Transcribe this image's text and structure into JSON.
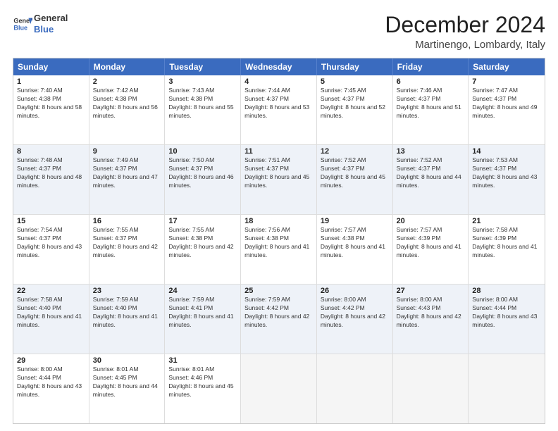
{
  "logo": {
    "line1": "General",
    "line2": "Blue"
  },
  "header": {
    "month": "December 2024",
    "location": "Martinengo, Lombardy, Italy"
  },
  "days_of_week": [
    "Sunday",
    "Monday",
    "Tuesday",
    "Wednesday",
    "Thursday",
    "Friday",
    "Saturday"
  ],
  "weeks": [
    {
      "alt": false,
      "cells": [
        {
          "day": "1",
          "sunrise": "Sunrise: 7:40 AM",
          "sunset": "Sunset: 4:38 PM",
          "daylight": "Daylight: 8 hours and 58 minutes."
        },
        {
          "day": "2",
          "sunrise": "Sunrise: 7:42 AM",
          "sunset": "Sunset: 4:38 PM",
          "daylight": "Daylight: 8 hours and 56 minutes."
        },
        {
          "day": "3",
          "sunrise": "Sunrise: 7:43 AM",
          "sunset": "Sunset: 4:38 PM",
          "daylight": "Daylight: 8 hours and 55 minutes."
        },
        {
          "day": "4",
          "sunrise": "Sunrise: 7:44 AM",
          "sunset": "Sunset: 4:37 PM",
          "daylight": "Daylight: 8 hours and 53 minutes."
        },
        {
          "day": "5",
          "sunrise": "Sunrise: 7:45 AM",
          "sunset": "Sunset: 4:37 PM",
          "daylight": "Daylight: 8 hours and 52 minutes."
        },
        {
          "day": "6",
          "sunrise": "Sunrise: 7:46 AM",
          "sunset": "Sunset: 4:37 PM",
          "daylight": "Daylight: 8 hours and 51 minutes."
        },
        {
          "day": "7",
          "sunrise": "Sunrise: 7:47 AM",
          "sunset": "Sunset: 4:37 PM",
          "daylight": "Daylight: 8 hours and 49 minutes."
        }
      ]
    },
    {
      "alt": true,
      "cells": [
        {
          "day": "8",
          "sunrise": "Sunrise: 7:48 AM",
          "sunset": "Sunset: 4:37 PM",
          "daylight": "Daylight: 8 hours and 48 minutes."
        },
        {
          "day": "9",
          "sunrise": "Sunrise: 7:49 AM",
          "sunset": "Sunset: 4:37 PM",
          "daylight": "Daylight: 8 hours and 47 minutes."
        },
        {
          "day": "10",
          "sunrise": "Sunrise: 7:50 AM",
          "sunset": "Sunset: 4:37 PM",
          "daylight": "Daylight: 8 hours and 46 minutes."
        },
        {
          "day": "11",
          "sunrise": "Sunrise: 7:51 AM",
          "sunset": "Sunset: 4:37 PM",
          "daylight": "Daylight: 8 hours and 45 minutes."
        },
        {
          "day": "12",
          "sunrise": "Sunrise: 7:52 AM",
          "sunset": "Sunset: 4:37 PM",
          "daylight": "Daylight: 8 hours and 45 minutes."
        },
        {
          "day": "13",
          "sunrise": "Sunrise: 7:52 AM",
          "sunset": "Sunset: 4:37 PM",
          "daylight": "Daylight: 8 hours and 44 minutes."
        },
        {
          "day": "14",
          "sunrise": "Sunrise: 7:53 AM",
          "sunset": "Sunset: 4:37 PM",
          "daylight": "Daylight: 8 hours and 43 minutes."
        }
      ]
    },
    {
      "alt": false,
      "cells": [
        {
          "day": "15",
          "sunrise": "Sunrise: 7:54 AM",
          "sunset": "Sunset: 4:37 PM",
          "daylight": "Daylight: 8 hours and 43 minutes."
        },
        {
          "day": "16",
          "sunrise": "Sunrise: 7:55 AM",
          "sunset": "Sunset: 4:37 PM",
          "daylight": "Daylight: 8 hours and 42 minutes."
        },
        {
          "day": "17",
          "sunrise": "Sunrise: 7:55 AM",
          "sunset": "Sunset: 4:38 PM",
          "daylight": "Daylight: 8 hours and 42 minutes."
        },
        {
          "day": "18",
          "sunrise": "Sunrise: 7:56 AM",
          "sunset": "Sunset: 4:38 PM",
          "daylight": "Daylight: 8 hours and 41 minutes."
        },
        {
          "day": "19",
          "sunrise": "Sunrise: 7:57 AM",
          "sunset": "Sunset: 4:38 PM",
          "daylight": "Daylight: 8 hours and 41 minutes."
        },
        {
          "day": "20",
          "sunrise": "Sunrise: 7:57 AM",
          "sunset": "Sunset: 4:39 PM",
          "daylight": "Daylight: 8 hours and 41 minutes."
        },
        {
          "day": "21",
          "sunrise": "Sunrise: 7:58 AM",
          "sunset": "Sunset: 4:39 PM",
          "daylight": "Daylight: 8 hours and 41 minutes."
        }
      ]
    },
    {
      "alt": true,
      "cells": [
        {
          "day": "22",
          "sunrise": "Sunrise: 7:58 AM",
          "sunset": "Sunset: 4:40 PM",
          "daylight": "Daylight: 8 hours and 41 minutes."
        },
        {
          "day": "23",
          "sunrise": "Sunrise: 7:59 AM",
          "sunset": "Sunset: 4:40 PM",
          "daylight": "Daylight: 8 hours and 41 minutes."
        },
        {
          "day": "24",
          "sunrise": "Sunrise: 7:59 AM",
          "sunset": "Sunset: 4:41 PM",
          "daylight": "Daylight: 8 hours and 41 minutes."
        },
        {
          "day": "25",
          "sunrise": "Sunrise: 7:59 AM",
          "sunset": "Sunset: 4:42 PM",
          "daylight": "Daylight: 8 hours and 42 minutes."
        },
        {
          "day": "26",
          "sunrise": "Sunrise: 8:00 AM",
          "sunset": "Sunset: 4:42 PM",
          "daylight": "Daylight: 8 hours and 42 minutes."
        },
        {
          "day": "27",
          "sunrise": "Sunrise: 8:00 AM",
          "sunset": "Sunset: 4:43 PM",
          "daylight": "Daylight: 8 hours and 42 minutes."
        },
        {
          "day": "28",
          "sunrise": "Sunrise: 8:00 AM",
          "sunset": "Sunset: 4:44 PM",
          "daylight": "Daylight: 8 hours and 43 minutes."
        }
      ]
    },
    {
      "alt": false,
      "cells": [
        {
          "day": "29",
          "sunrise": "Sunrise: 8:00 AM",
          "sunset": "Sunset: 4:44 PM",
          "daylight": "Daylight: 8 hours and 43 minutes."
        },
        {
          "day": "30",
          "sunrise": "Sunrise: 8:01 AM",
          "sunset": "Sunset: 4:45 PM",
          "daylight": "Daylight: 8 hours and 44 minutes."
        },
        {
          "day": "31",
          "sunrise": "Sunrise: 8:01 AM",
          "sunset": "Sunset: 4:46 PM",
          "daylight": "Daylight: 8 hours and 45 minutes."
        },
        {
          "day": "",
          "sunrise": "",
          "sunset": "",
          "daylight": ""
        },
        {
          "day": "",
          "sunrise": "",
          "sunset": "",
          "daylight": ""
        },
        {
          "day": "",
          "sunrise": "",
          "sunset": "",
          "daylight": ""
        },
        {
          "day": "",
          "sunrise": "",
          "sunset": "",
          "daylight": ""
        }
      ]
    }
  ]
}
